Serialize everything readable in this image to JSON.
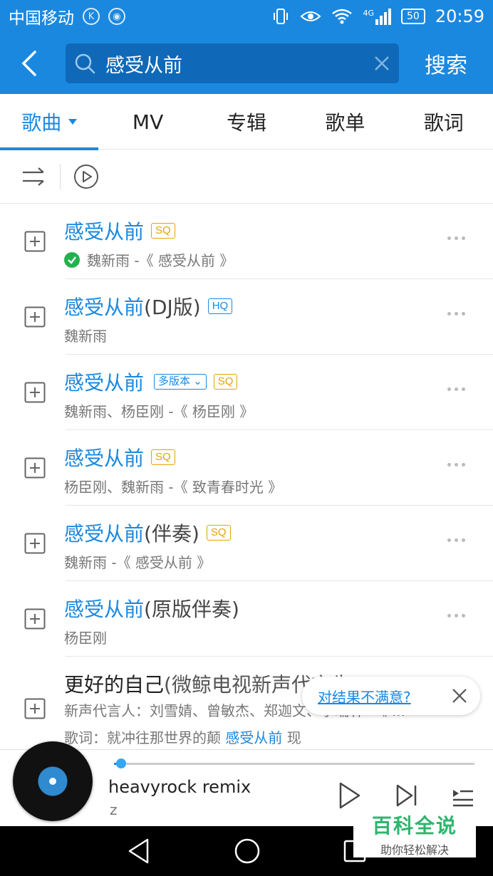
{
  "status_bar": {
    "carrier": "中国移动",
    "network": "4G",
    "battery": "50",
    "time": "20:59"
  },
  "header": {
    "search_query": "感受从前",
    "search_button": "搜索"
  },
  "tabs": [
    {
      "label": "歌曲",
      "active": true
    },
    {
      "label": "MV"
    },
    {
      "label": "专辑"
    },
    {
      "label": "歌单"
    },
    {
      "label": "歌词"
    }
  ],
  "songs": [
    {
      "title": "感受从前",
      "version": "",
      "badges": [
        "SQ"
      ],
      "subtitle": "魏新雨 -《 感受从前 》",
      "downloaded": true
    },
    {
      "title": "感受从前",
      "version": " (DJ版)",
      "badges": [
        "HQ"
      ],
      "subtitle": "魏新雨"
    },
    {
      "title": "感受从前",
      "version": "",
      "multi_version": "多版本",
      "badges": [
        "SQ"
      ],
      "subtitle": "魏新雨、杨臣刚 -《 杨臣刚 》"
    },
    {
      "title": "感受从前",
      "version": "",
      "badges": [
        "SQ"
      ],
      "subtitle": "杨臣刚、魏新雨 -《 致青春时光 》"
    },
    {
      "title": "感受从前",
      "version": " (伴奏)",
      "badges": [
        "SQ"
      ],
      "subtitle": "魏新雨 -《 感受从前 》"
    },
    {
      "title": "感受从前",
      "version": " (原版伴奏)",
      "badges": [],
      "subtitle": "杨臣刚"
    },
    {
      "title": "更好的自己",
      "version": " (微鲸电视新声代言先",
      "badges": [],
      "subtitle": "新声代言人：刘雪婧、曾敏杰、郑迦文、李瑞轩 -《 ...",
      "lyric_prefix": "歌词：就冲往那世界的颠 ",
      "lyric_highlight": "感受从前",
      "lyric_suffix": " 现"
    }
  ],
  "feedback": {
    "text": "对结果不满意?"
  },
  "player": {
    "title": "heavyrock remix",
    "artist": "z",
    "progress": 0.02
  },
  "watermark": {
    "title": "百科全说",
    "subtitle": "助你轻松解决"
  },
  "colors": {
    "primary": "#1b88e0",
    "sq_badge": "#e3a400",
    "check_green": "#23b14d"
  }
}
